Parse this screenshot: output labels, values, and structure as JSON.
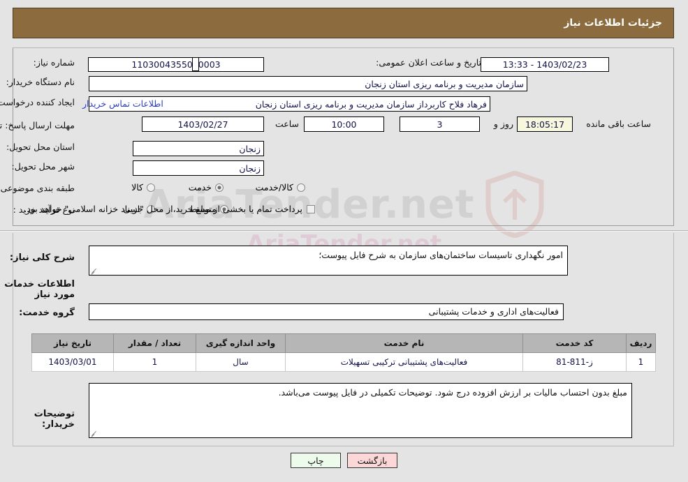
{
  "header": {
    "title": "جزئیات اطلاعات نیاز",
    "bg_color": "#8c6c3e"
  },
  "top_form": {
    "need_number_label": "شماره نیاز:",
    "need_number_value": "1103004355000003",
    "announce_datetime_label": "تاریخ و ساعت اعلان عمومی:",
    "announce_datetime_value": "1403/02/23 - 13:33",
    "buyer_org_label": "نام دستگاه خریدار:",
    "buyer_org_value": "سازمان مدیریت و برنامه ریزی استان زنجان",
    "creator_label": "ایجاد کننده درخواست:",
    "creator_value": "فرهاد فلاح کاربرداز سازمان مدیریت و برنامه ریزی استان زنجان",
    "contact_link": "اطلاعات تماس خریدار",
    "deadline_label": "مهلت ارسال پاسخ: تا تاریخ:",
    "deadline_date_value": "1403/02/27",
    "hour_label": "ساعت",
    "deadline_time_value": "10:00",
    "days_value": "3",
    "days_label": "روز و",
    "remaining_time_value": "18:05:17",
    "remaining_label": "ساعت باقی مانده",
    "province_label": "استان محل تحویل:",
    "province_value": "زنجان",
    "city_label": "شهر محل تحویل:",
    "city_value": "زنجان",
    "category_label": "طبقه بندی موضوعی:",
    "category_options": [
      {
        "label": "کالا",
        "selected": false
      },
      {
        "label": "خدمت",
        "selected": true
      },
      {
        "label": "کالا/خدمت",
        "selected": false
      }
    ],
    "process_label": "نوع فرآیند خرید :",
    "process_options": [
      {
        "label": "جزیی",
        "selected": false
      },
      {
        "label": "متوسط",
        "selected": true
      }
    ],
    "treasury_checkbox_label": "پرداخت تمام یا بخشی از مبلغ خرید،از محل \"اسناد خزانه اسلامی\" خواهد بود.",
    "treasury_checked": false
  },
  "middle": {
    "general_desc_label": "شرح کلی نیاز:",
    "general_desc_value": "امور نگهداری تاسیسات ساختمان‌های سازمان به شرح فایل پیوست؛",
    "services_info_heading": "اطلاعات خدمات مورد نیاز",
    "service_group_label": "گروه خدمت:",
    "service_group_value": "فعالیت‌های اداری و خدمات پشتیبانی",
    "buyer_notes_label": "توضیحات خریدار:",
    "buyer_notes_value": "مبلغ بدون احتساب مالیات بر ارزش افزوده درج شود. توضیحات تکمیلی در فایل پیوست می‌باشد."
  },
  "table": {
    "columns": [
      "ردیف",
      "کد خدمت",
      "نام خدمت",
      "واحد اندازه گیری",
      "تعداد / مقدار",
      "تاریخ نیاز"
    ],
    "rows": [
      {
        "row": "1",
        "code": "ز-811-81",
        "name": "فعالیت‌های پشتیبانی ترکیبی تسهیلات",
        "unit": "سال",
        "qty": "1",
        "date": "1403/03/01"
      }
    ]
  },
  "footer": {
    "print_label": "چاپ",
    "back_label": "بازگشت"
  },
  "watermark": {
    "text": "AriaTender.net",
    "top_text": "AriaTender.net"
  }
}
